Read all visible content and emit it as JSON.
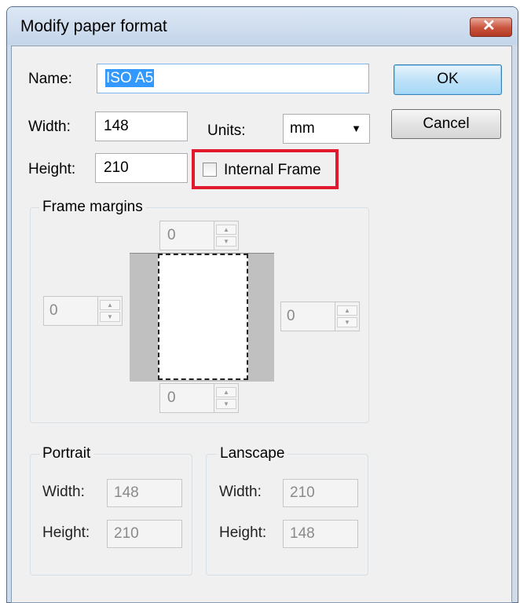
{
  "window": {
    "title": "Modify paper format",
    "close_icon": "close-icon"
  },
  "form": {
    "name_label": "Name:",
    "name_value": "ISO A5",
    "width_label": "Width:",
    "width_value": "148",
    "height_label": "Height:",
    "height_value": "210",
    "units_label": "Units:",
    "units_value": "mm",
    "internal_frame_label": "Internal Frame",
    "internal_frame_checked": false
  },
  "buttons": {
    "ok": "OK",
    "cancel": "Cancel"
  },
  "frame_margins": {
    "title": "Frame margins",
    "top": "0",
    "left": "0",
    "right": "0",
    "bottom": "0"
  },
  "portrait": {
    "title": "Portrait",
    "width_label": "Width:",
    "width_value": "148",
    "height_label": "Height:",
    "height_value": "210"
  },
  "landscape": {
    "title": "Lanscape",
    "width_label": "Width:",
    "width_value": "210",
    "height_label": "Height:",
    "height_value": "148"
  },
  "colors": {
    "highlight_box": "#e0192f",
    "selection": "#3399ff"
  }
}
